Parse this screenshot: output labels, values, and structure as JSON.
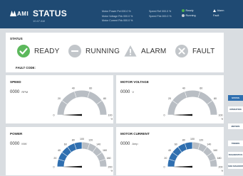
{
  "header": {
    "brand": "AMI",
    "title": "STATUS",
    "time": "10:47 AM",
    "metrics": [
      {
        "text": "Motor Power Pct   000.0  %"
      },
      {
        "text": "Motor Voltage Fbk   000.0  %"
      },
      {
        "text": "Motor Current Fbk   000.0  %"
      },
      {
        "text": "Speed Ref   000.0  %"
      },
      {
        "text": "Speed Fbk   000.0  %"
      }
    ],
    "indicators": {
      "ready": "Ready",
      "running": "Running",
      "alarm": "Alarm",
      "fault": "Fault"
    },
    "colors": {
      "bar": "#1f4a73",
      "ready": "#4caf50",
      "running": "#c7ced6"
    }
  },
  "status_panel": {
    "title": "STATUS",
    "items": [
      {
        "label": "READY",
        "icon": "check-circle-icon",
        "color": "#5cb85c"
      },
      {
        "label": "RUNNING",
        "icon": "minus-circle-icon",
        "color": "#c2c6ca"
      },
      {
        "label": "ALARM",
        "icon": "warning-triangle-icon",
        "color": "#c2c6ca"
      },
      {
        "label": "FAULT",
        "icon": "x-circle-icon",
        "color": "#c2c6ca"
      }
    ],
    "fault_code_label": "FAULT CODE:"
  },
  "gauges": [
    {
      "title": "SPEED",
      "value": "0000",
      "unit": "RPM",
      "max": 100,
      "ticks": [
        "0",
        "20",
        "40",
        "60",
        "80",
        "100"
      ],
      "end_label": "%",
      "fill_fraction": 0,
      "fill_color": "#2f6fb0"
    },
    {
      "title": "MOTOR VOLTAGE",
      "value": "0000",
      "unit": "V",
      "max": 100,
      "ticks": [
        "0",
        "20",
        "40",
        "60",
        "80",
        "100"
      ],
      "end_label": "%",
      "fill_fraction": 0,
      "fill_color": "#2f6fb0"
    },
    {
      "title": "POWER",
      "value": "0000",
      "unit": "MW",
      "max": 200,
      "ticks": [
        "0",
        "20",
        "40",
        "60",
        "80",
        "100",
        "120",
        "140",
        "160",
        "180",
        "200"
      ],
      "end_label": "%",
      "fill_fraction": 0.5,
      "fill_color": "#2f6fb0"
    },
    {
      "title": "MOTOR CURRENT",
      "value": "0000",
      "unit": "Amp",
      "max": 200,
      "ticks": [
        "0",
        "20",
        "40",
        "60",
        "80",
        "100",
        "120",
        "140",
        "160",
        "180",
        "200"
      ],
      "end_label": "%",
      "fill_fraction": 0.5,
      "fill_color": "#2f6fb0"
    }
  ],
  "sidenav": {
    "items": [
      {
        "label": "STATUS",
        "active": true
      },
      {
        "label": "OPERATION",
        "active": false
      },
      {
        "label": "METERS",
        "active": false
      },
      {
        "label": "TRENDS",
        "active": false
      },
      {
        "label": "DIAGNOSTICS",
        "active": false
      },
      {
        "label": "SOE DIAGNOSTICS",
        "active": false
      }
    ]
  }
}
